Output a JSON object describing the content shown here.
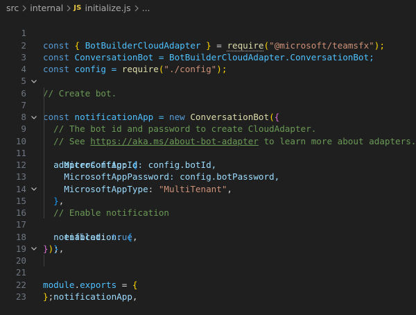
{
  "breadcrumb": {
    "items": [
      "src",
      "internal",
      "initialize.js",
      "..."
    ],
    "file_icon_label": "JS"
  },
  "editor": {
    "line_numbers": [
      "1",
      "2",
      "3",
      "4",
      "5",
      "6",
      "7",
      "8",
      "9",
      "10",
      "11",
      "12",
      "13",
      "14",
      "15",
      "16",
      "17",
      "18",
      "19",
      "20",
      "21",
      "22",
      "23"
    ],
    "lines": [
      [
        "const",
        " ",
        "{",
        " BotBuilderCloudAdapter ",
        "}",
        " = ",
        "require",
        "(",
        "\"@microsoft/teamsfx\"",
        ");"
      ],
      [
        "const",
        " ConversationBot = BotBuilderCloudAdapter.ConversationBot;"
      ],
      [
        "const",
        " config = ",
        "require",
        "(",
        "\"./config\"",
        ");"
      ],
      [],
      [
        "// Create bot."
      ],
      [
        "const",
        " notificationApp = ",
        "new",
        " ",
        "ConversationBot",
        "(",
        "{"
      ],
      [
        "  ",
        "// The bot id and password to create CloudAdapter."
      ],
      [
        "  ",
        "// See ",
        "https://aka.ms/about-bot-adapter",
        " to learn more about adapters."
      ],
      [
        "  ",
        "adapterConfig",
        ": ",
        "{"
      ],
      [
        "    ",
        "MicrosoftAppId",
        ": config.botId,"
      ],
      [
        "    ",
        "MicrosoftAppPassword",
        ": config.botPassword,"
      ],
      [
        "    ",
        "MicrosoftAppType",
        ": ",
        "\"MultiTenant\"",
        ","
      ],
      [
        "  ",
        "}",
        ","
      ],
      [
        "  ",
        "// Enable notification"
      ],
      [
        "  ",
        "notification",
        ": ",
        "{"
      ],
      [
        "    ",
        "enabled",
        ": ",
        "true",
        ","
      ],
      [
        "  ",
        "}",
        ","
      ],
      [
        "}",
        ")",
        ";"
      ],
      [],
      [
        "module",
        ".",
        "exports",
        " = ",
        "{"
      ],
      [
        "  ",
        "notificationApp",
        ","
      ],
      [
        "}",
        ";"
      ],
      []
    ],
    "foldable_lines": [
      "6",
      "9",
      "15",
      "20"
    ]
  },
  "colors": {
    "background": "#1f1f1f",
    "keyword": "#569cd6",
    "variable": "#4fc1ff",
    "property": "#9cdcfe",
    "function": "#dcdcaa",
    "string": "#ce9178",
    "comment": "#6a9955",
    "bracket_level1": "#ffd700",
    "bracket_level2": "#da70d6",
    "bracket_level3": "#179fff",
    "line_number": "#6e7681"
  }
}
